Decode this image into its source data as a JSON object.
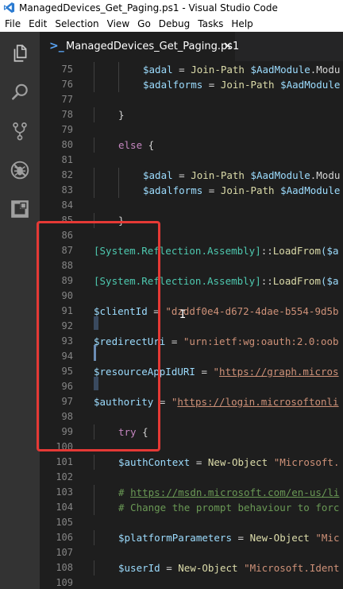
{
  "window": {
    "title": "ManagedDevices_Get_Paging.ps1 - Visual Studio Code"
  },
  "menu": [
    "File",
    "Edit",
    "Selection",
    "View",
    "Go",
    "Debug",
    "Tasks",
    "Help"
  ],
  "activity_bar": [
    "files-icon",
    "search-icon",
    "source-control-icon",
    "debug-icon",
    "extensions-icon"
  ],
  "tab": {
    "icon": ">_",
    "label": "ManagedDevices_Get_Paging.ps1",
    "close": "×"
  },
  "editor": {
    "lines": [
      {
        "num": "75",
        "tokens": [
          [
            "$adal",
            "var",
            2
          ],
          [
            " = ",
            "",
            0
          ],
          [
            "Join-Path",
            "fn",
            0
          ],
          [
            " ",
            "",
            0
          ],
          [
            "$AadModule",
            "var",
            0
          ],
          [
            ".Modu",
            "",
            0
          ]
        ]
      },
      {
        "num": "76",
        "tokens": [
          [
            "$adalforms",
            "var",
            2
          ],
          [
            " = ",
            "",
            0
          ],
          [
            "Join-Path",
            "fn",
            0
          ],
          [
            " ",
            "",
            0
          ],
          [
            "$AadModule",
            "var",
            0
          ]
        ]
      },
      {
        "num": "77",
        "tokens": []
      },
      {
        "num": "78",
        "tokens": [
          [
            "}",
            "",
            1
          ]
        ]
      },
      {
        "num": "79",
        "tokens": []
      },
      {
        "num": "80",
        "tokens": [
          [
            "else",
            "kw",
            1
          ],
          [
            " {",
            "",
            0
          ]
        ]
      },
      {
        "num": "81",
        "tokens": []
      },
      {
        "num": "82",
        "tokens": [
          [
            "$adal",
            "var",
            2
          ],
          [
            " = ",
            "",
            0
          ],
          [
            "Join-Path",
            "fn",
            0
          ],
          [
            " ",
            "",
            0
          ],
          [
            "$AadModule",
            "var",
            0
          ],
          [
            ".Modu",
            "",
            0
          ]
        ]
      },
      {
        "num": "83",
        "tokens": [
          [
            "$adalforms",
            "var",
            2
          ],
          [
            " = ",
            "",
            0
          ],
          [
            "Join-Path",
            "fn",
            0
          ],
          [
            " ",
            "",
            0
          ],
          [
            "$AadModule",
            "var",
            0
          ]
        ]
      },
      {
        "num": "84",
        "tokens": []
      },
      {
        "num": "85",
        "tokens": [
          [
            "}",
            "",
            1
          ]
        ]
      },
      {
        "num": "86",
        "tokens": []
      },
      {
        "num": "87",
        "tokens": [
          [
            "[System.Reflection.Assembly]",
            "ty",
            0
          ],
          [
            "::",
            "",
            0
          ],
          [
            "LoadFrom",
            "fn",
            0
          ],
          [
            "($a",
            "var",
            0
          ]
        ]
      },
      {
        "num": "88",
        "tokens": []
      },
      {
        "num": "89",
        "tokens": [
          [
            "[System.Reflection.Assembly]",
            "ty",
            0
          ],
          [
            "::",
            "",
            0
          ],
          [
            "LoadFrom",
            "fn",
            0
          ],
          [
            "($a",
            "var",
            0
          ]
        ]
      },
      {
        "num": "90",
        "tokens": []
      },
      {
        "num": "91",
        "tokens": [
          [
            "$clientId",
            "var",
            0
          ],
          [
            " = ",
            "",
            0
          ],
          [
            "\"dzddf0e4-d672-4dae-b554-9d5b",
            "str",
            0
          ]
        ]
      },
      {
        "num": "92",
        "tokens": []
      },
      {
        "num": "93",
        "tokens": [
          [
            "$redirectUri",
            "var",
            0
          ],
          [
            " = ",
            "",
            0
          ],
          [
            "\"urn:ietf:wg:oauth:2.0:oob",
            "str",
            0
          ]
        ]
      },
      {
        "num": "94",
        "tokens": []
      },
      {
        "num": "95",
        "tokens": [
          [
            "$resourceAppIdURI",
            "var",
            0
          ],
          [
            " = ",
            "",
            0
          ],
          [
            "\"",
            "str",
            0
          ],
          [
            "https://graph.micros",
            "url",
            0
          ]
        ]
      },
      {
        "num": "96",
        "tokens": []
      },
      {
        "num": "97",
        "tokens": [
          [
            "$authority",
            "var",
            0
          ],
          [
            " = ",
            "",
            0
          ],
          [
            "\"",
            "str",
            0
          ],
          [
            "https://login.microsoftonli",
            "url",
            0
          ]
        ]
      },
      {
        "num": "98",
        "tokens": []
      },
      {
        "num": "99",
        "tokens": [
          [
            "try",
            "kw",
            1
          ],
          [
            " {",
            "",
            0
          ]
        ]
      },
      {
        "num": "100",
        "tokens": []
      },
      {
        "num": "101",
        "tokens": [
          [
            "$authContext",
            "var",
            1
          ],
          [
            " = ",
            "",
            0
          ],
          [
            "New-Object",
            "fn",
            0
          ],
          [
            " ",
            "",
            0
          ],
          [
            "\"Microsoft.",
            "str",
            0
          ]
        ]
      },
      {
        "num": "102",
        "tokens": []
      },
      {
        "num": "103",
        "tokens": [
          [
            "# ",
            "cm",
            1
          ],
          [
            "https://msdn.microsoft.com/en-us/li",
            "cmurl",
            0
          ]
        ]
      },
      {
        "num": "104",
        "tokens": [
          [
            "# Change the prompt behaviour to forc",
            "cm",
            1
          ]
        ]
      },
      {
        "num": "105",
        "tokens": []
      },
      {
        "num": "106",
        "tokens": [
          [
            "$platformParameters",
            "var",
            1
          ],
          [
            " = ",
            "",
            0
          ],
          [
            "New-Object",
            "fn",
            0
          ],
          [
            " ",
            "",
            0
          ],
          [
            "\"Mic",
            "str",
            0
          ]
        ]
      },
      {
        "num": "107",
        "tokens": []
      },
      {
        "num": "108",
        "tokens": [
          [
            "$userId",
            "var",
            1
          ],
          [
            " = ",
            "",
            0
          ],
          [
            "New-Object",
            "fn",
            0
          ],
          [
            " ",
            "",
            0
          ],
          [
            "\"Microsoft.Ident",
            "str",
            0
          ]
        ]
      },
      {
        "num": "109",
        "tokens": []
      }
    ]
  }
}
